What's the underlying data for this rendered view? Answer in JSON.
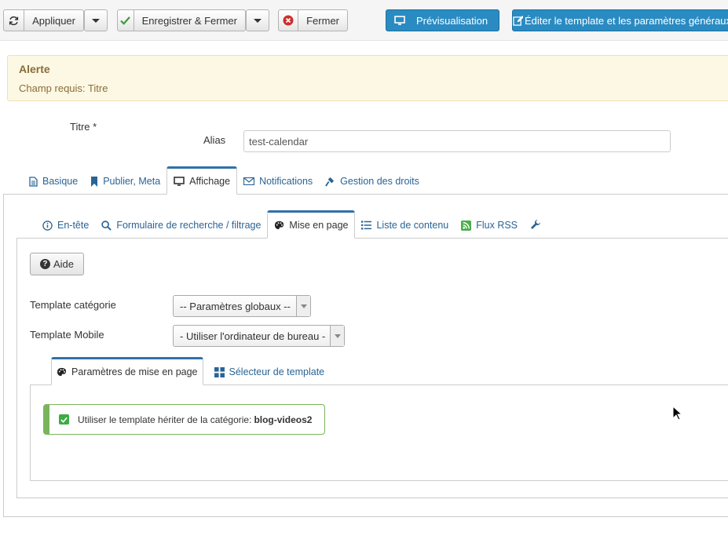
{
  "toolbar": {
    "apply_label": "Appliquer",
    "save_close_label": "Enregistrer & Fermer",
    "close_label": "Fermer",
    "preview_label": "Prévisualisation",
    "edit_template_label": "Éditer le template et les paramètres généraux"
  },
  "alert": {
    "heading": "Alerte",
    "message": "Champ requis: Titre"
  },
  "form": {
    "title_label": "Titre *",
    "alias_label": "Alias",
    "alias_value": "test-calendar"
  },
  "main_tabs": [
    "Basique",
    "Publier, Meta",
    "Affichage",
    "Notifications",
    "Gestion des droits"
  ],
  "sub_tabs": [
    "En-tête",
    "Formulaire de recherche / filtrage",
    "Mise en page",
    "Liste de contenu",
    "Flux RSS"
  ],
  "layout": {
    "help_label": "Aide",
    "category_template_label": "Template catégorie",
    "category_template_value": "-- Paramètres globaux --",
    "mobile_template_label": "Template Mobile",
    "mobile_template_value": "- Utiliser l'ordinateur de bureau -",
    "inner_tabs": [
      "Paramètres de mise en page",
      "Sélecteur de template"
    ],
    "inherit_message": "Utiliser le template hériter de la catégorie:",
    "inherit_category": "blog-videos2"
  },
  "colors": {
    "accent": "#2a8bc2",
    "link": "#2a6496",
    "success": "#7ab55c",
    "alert_bg": "#fcf8e3"
  }
}
